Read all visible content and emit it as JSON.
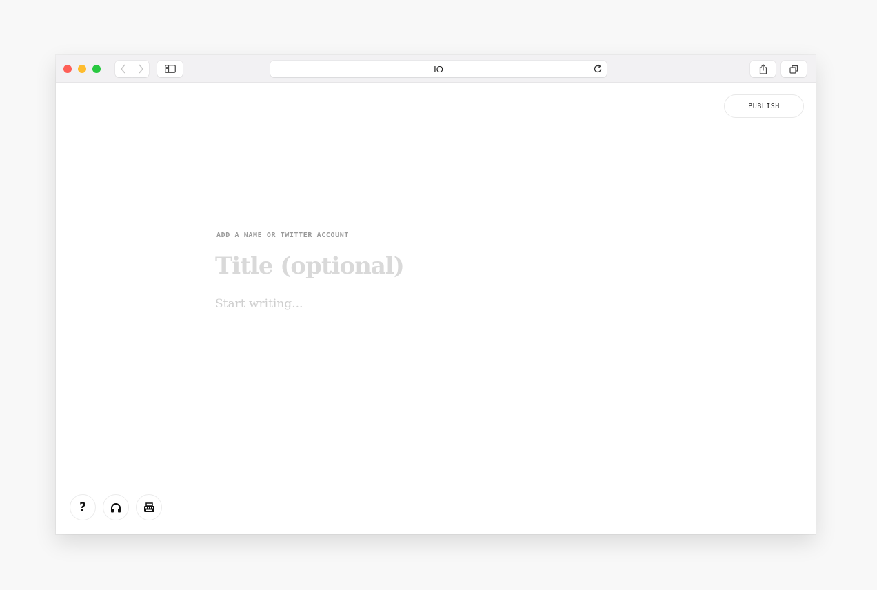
{
  "browser": {
    "address_text": "IO"
  },
  "header": {
    "publish_label": "PUBLISH"
  },
  "editor": {
    "byline_prefix": "ADD A NAME OR ",
    "byline_link": "TWITTER ACCOUNT",
    "title_placeholder": "Title (optional)",
    "body_placeholder": "Start writing..."
  },
  "footer": {
    "help_label": "?",
    "buttons": [
      "question-mark-icon",
      "headphones-icon",
      "typewriter-icon"
    ]
  },
  "colors": {
    "close": "#fe5f57",
    "minimize": "#febc2e",
    "maximize": "#28c840",
    "placeholder": "#d9d9d9"
  }
}
